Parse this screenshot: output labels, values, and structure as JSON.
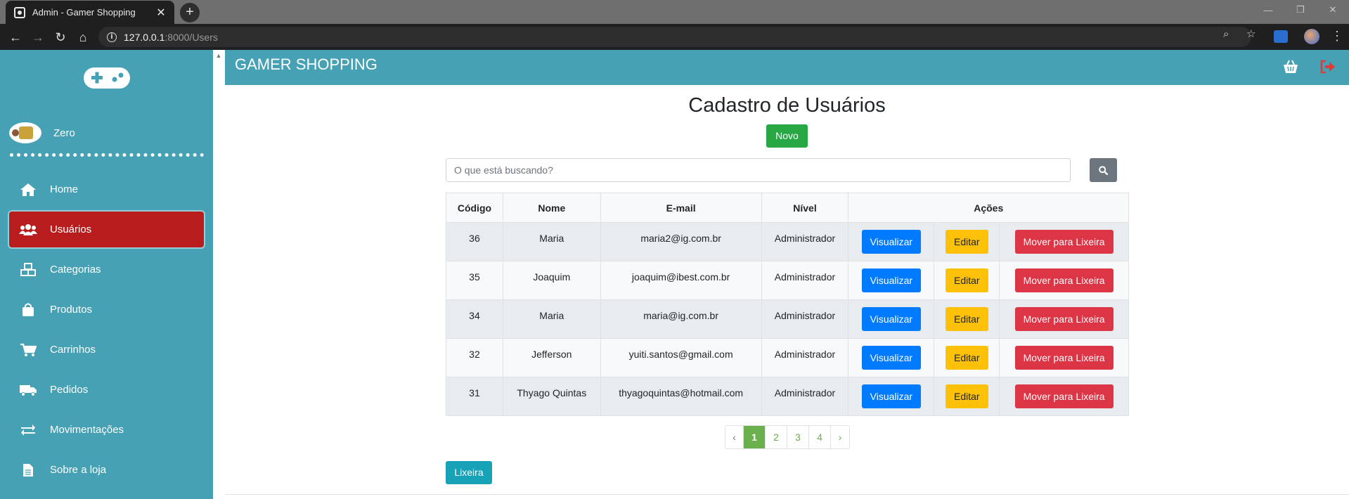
{
  "browser": {
    "tab_title": "Admin - Gamer Shopping",
    "tab_close": "✕",
    "new_tab": "+",
    "url_host": "127.0.0.1",
    "url_rest": ":8000/Users",
    "back": "←",
    "forward": "→",
    "reload": "↻",
    "home": "⌂",
    "zoom_icon": "⌕",
    "star_icon": "☆",
    "menu_icon": "⋮",
    "minimize": "—",
    "restore": "❐",
    "close": "✕"
  },
  "sidebar": {
    "user_name": "Zero",
    "items": [
      {
        "label": "Home",
        "icon": "home-icon",
        "active": false
      },
      {
        "label": "Usuários",
        "icon": "users-icon",
        "active": true
      },
      {
        "label": "Categorias",
        "icon": "boxes-icon",
        "active": false
      },
      {
        "label": "Produtos",
        "icon": "shopping-bag-icon",
        "active": false
      },
      {
        "label": "Carrinhos",
        "icon": "cart-icon",
        "active": false
      },
      {
        "label": "Pedidos",
        "icon": "truck-icon",
        "active": false
      },
      {
        "label": "Movimentações",
        "icon": "exchange-icon",
        "active": false
      },
      {
        "label": "Sobre a loja",
        "icon": "file-icon",
        "active": false
      }
    ]
  },
  "topbar": {
    "title": "GAMER SHOPPING"
  },
  "main": {
    "page_title": "Cadastro de Usuários",
    "new_button": "Novo",
    "search_placeholder": "O que está buscando?",
    "trash_button": "Lixeira"
  },
  "table": {
    "headers": [
      "Código",
      "Nome",
      "E-mail",
      "Nível",
      "Ações"
    ],
    "rows": [
      {
        "code": "36",
        "name": "Maria",
        "email": "maria2@ig.com.br",
        "level": "Administrador"
      },
      {
        "code": "35",
        "name": "Joaquim",
        "email": "joaquim@ibest.com.br",
        "level": "Administrador"
      },
      {
        "code": "34",
        "name": "Maria",
        "email": "maria@ig.com.br",
        "level": "Administrador"
      },
      {
        "code": "32",
        "name": "Jefferson",
        "email": "yuiti.santos@gmail.com",
        "level": "Administrador"
      },
      {
        "code": "31",
        "name": "Thyago Quintas",
        "email": "thyagoquintas@hotmail.com",
        "level": "Administrador"
      }
    ],
    "actions": {
      "view": "Visualizar",
      "edit": "Editar",
      "trash": "Mover para Lixeira"
    }
  },
  "pagination": {
    "prev": "‹",
    "pages": [
      "1",
      "2",
      "3",
      "4"
    ],
    "current": "1",
    "next": "›"
  },
  "colors": {
    "sidebar": "#46a1b4",
    "active_item": "#b91c1c",
    "new_button": "#28a745",
    "view_button": "#007bff",
    "edit_button": "#ffc107",
    "trash_button": "#dc3545",
    "lixeira_button": "#17a2b8",
    "pagination_accent": "#6ab04c",
    "logout_icon": "#e53935"
  }
}
